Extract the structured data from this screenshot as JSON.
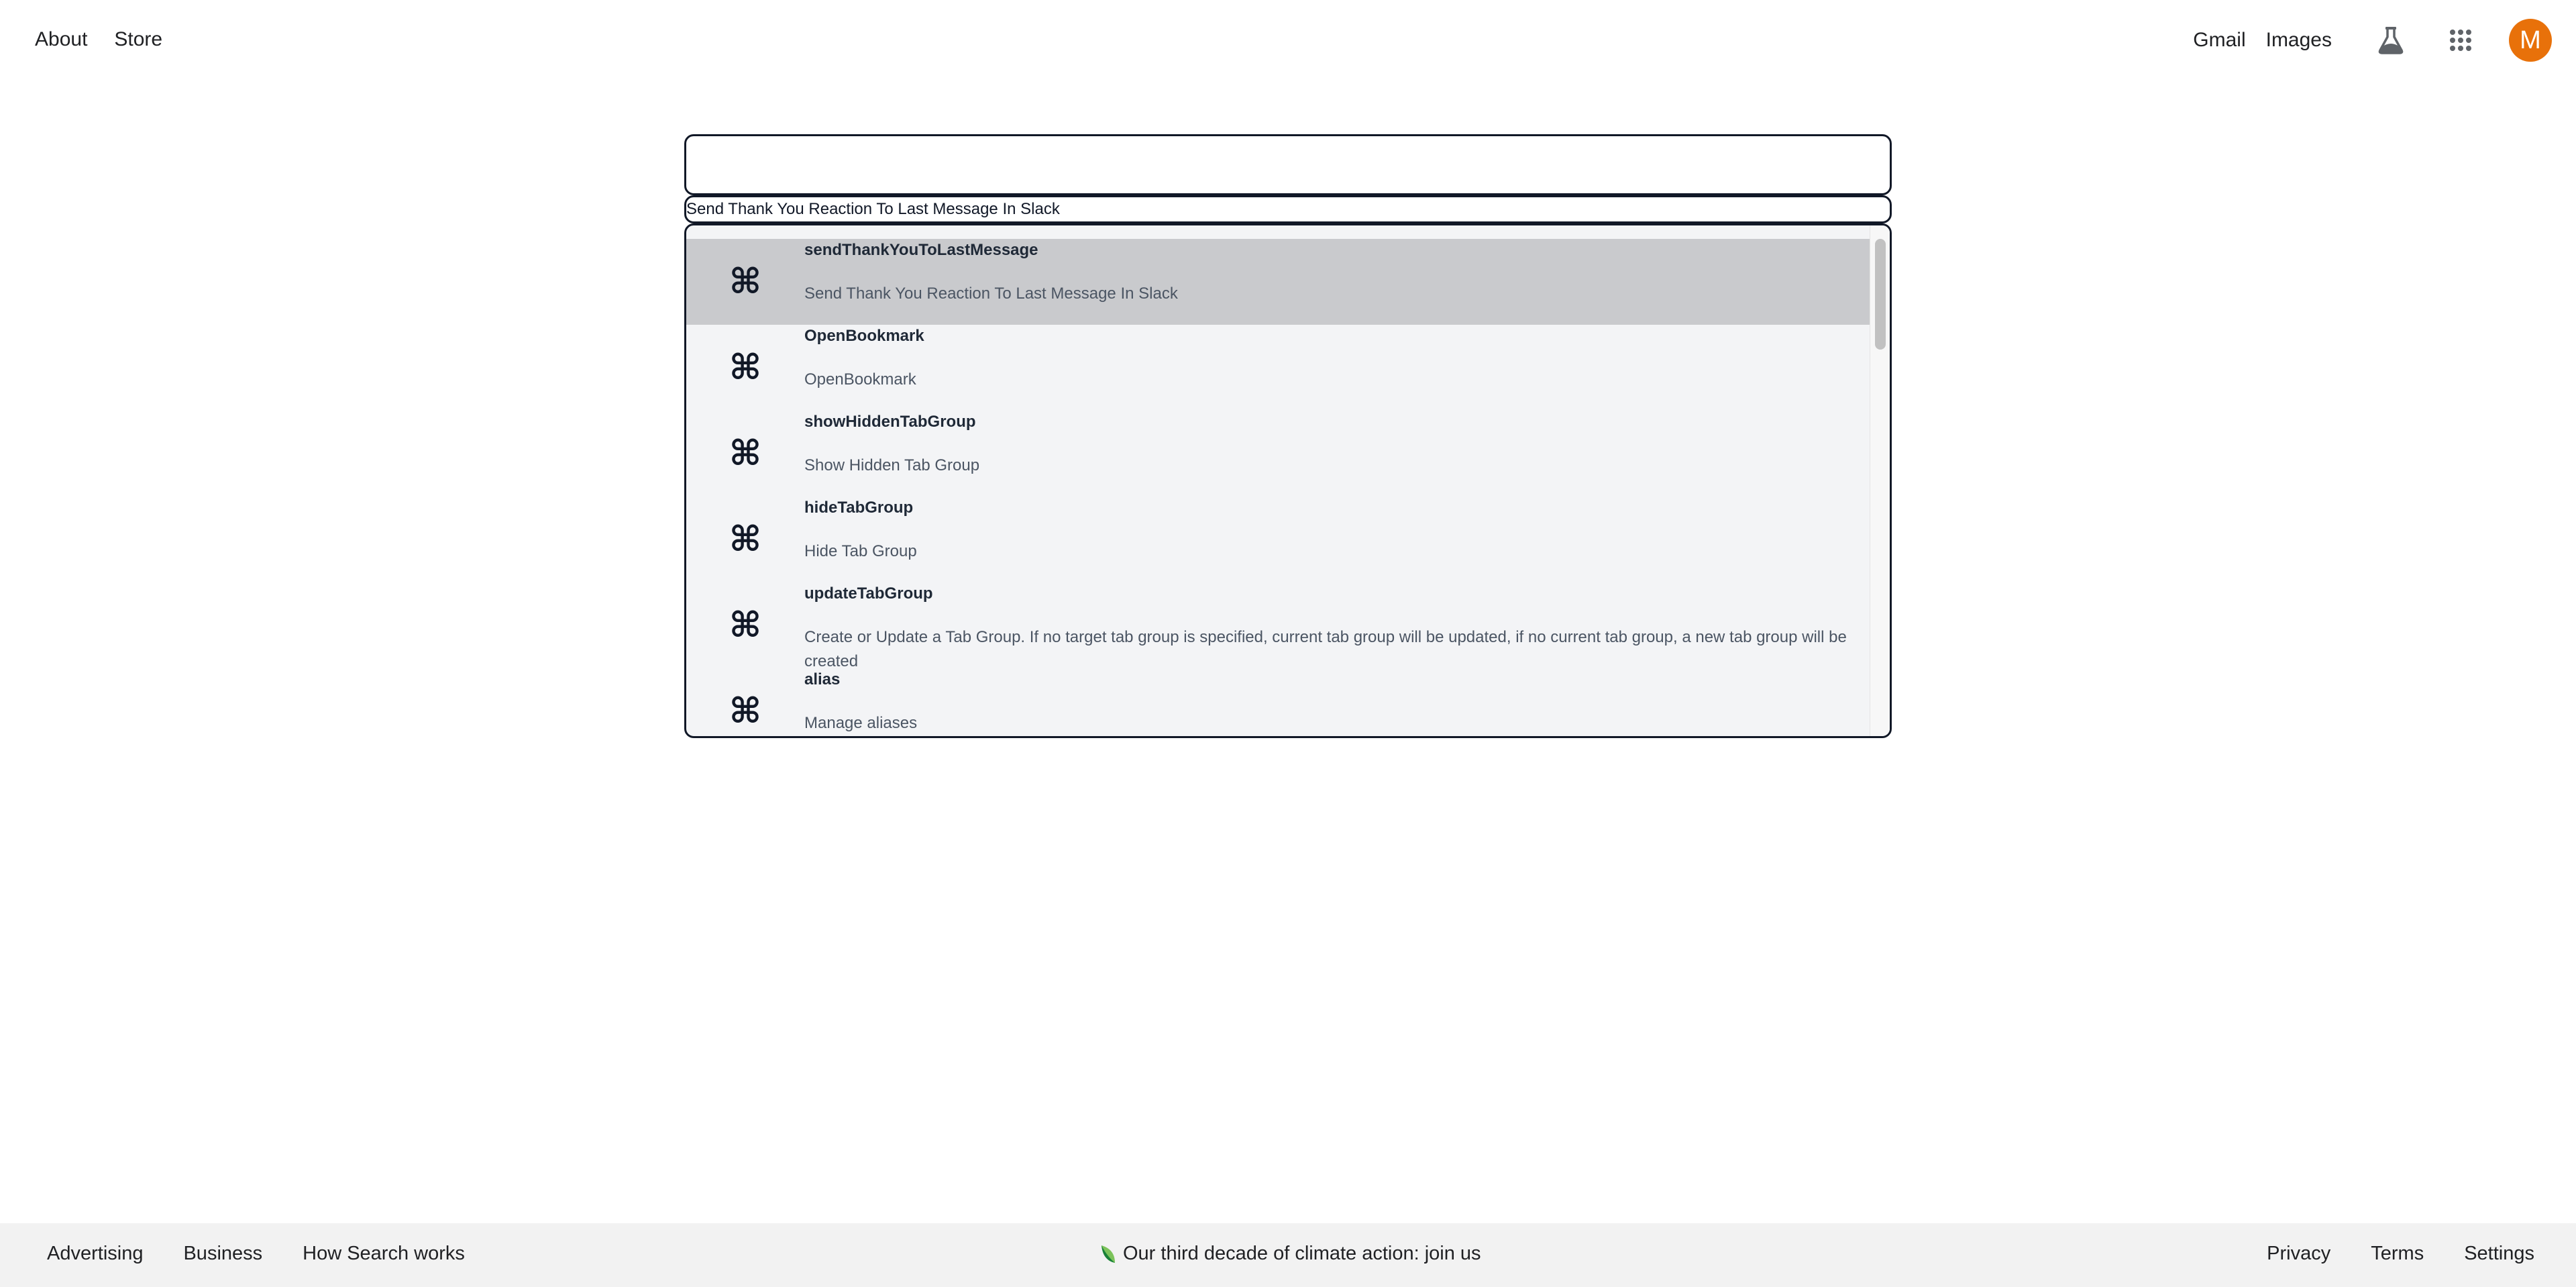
{
  "header": {
    "left_links": [
      "About",
      "Store"
    ],
    "right_links": [
      "Gmail",
      "Images"
    ],
    "labs_icon": "labs-flask-icon",
    "apps_icon": "apps-grid-icon",
    "avatar_letter": "M",
    "avatar_color": "#e8710a"
  },
  "search": {
    "value": "",
    "placeholder": "",
    "selected_text": "Send Thank You Reaction To Last Message In Slack"
  },
  "results": {
    "icon": "⌘",
    "items": [
      {
        "title": "sendThankYouToLastMessage",
        "description": "Send Thank You Reaction To Last Message In Slack",
        "active": true
      },
      {
        "title": "OpenBookmark",
        "description": "OpenBookmark",
        "active": false
      },
      {
        "title": "showHiddenTabGroup",
        "description": "Show Hidden Tab Group",
        "active": false
      },
      {
        "title": "hideTabGroup",
        "description": "Hide Tab Group",
        "active": false
      },
      {
        "title": "updateTabGroup",
        "description": "Create or Update a Tab Group. If no target tab group is specified, current tab group will be updated, if no current tab group, a new tab group will be created",
        "active": false
      },
      {
        "title": "alias",
        "description": "Manage aliases",
        "active": false
      }
    ]
  },
  "footer": {
    "left_links": [
      "Advertising",
      "Business",
      "How Search works"
    ],
    "center_text": "Our third decade of climate action: join us",
    "right_links": [
      "Privacy",
      "Terms",
      "Settings"
    ]
  },
  "colors": {
    "active_row": "#c9cacd",
    "list_bg": "#f3f4f6",
    "border": "#111827",
    "footer_bg": "#f2f2f2"
  }
}
